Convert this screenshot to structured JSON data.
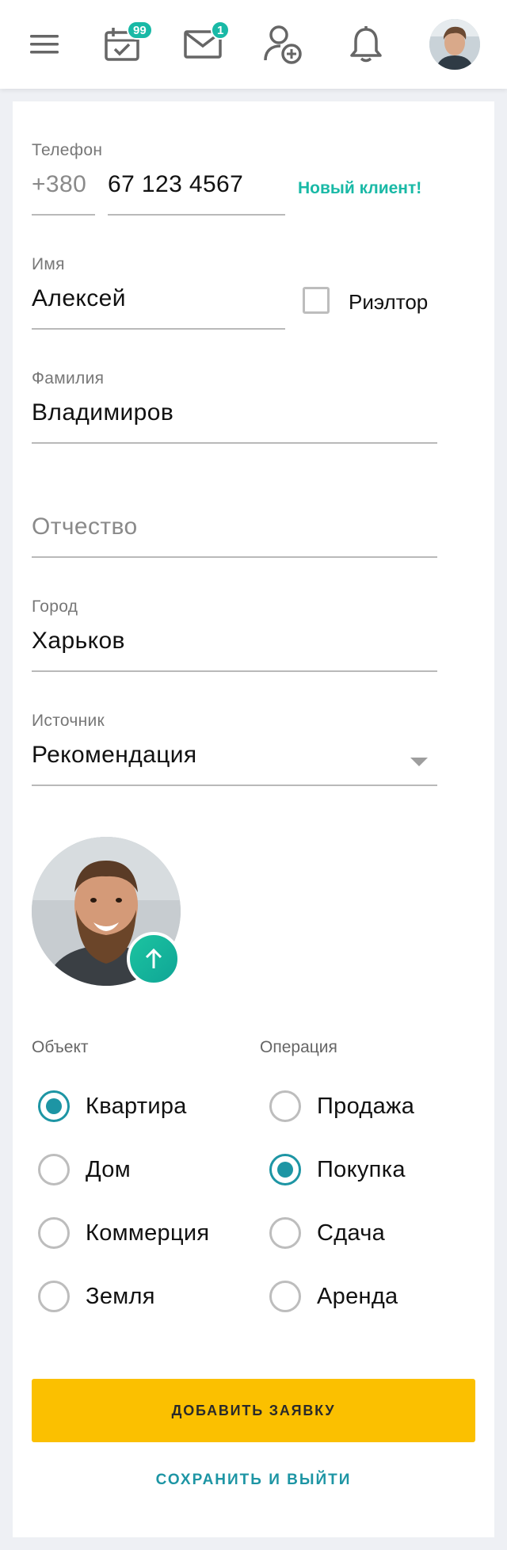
{
  "header": {
    "menu_icon": "hamburger-icon",
    "calendar_icon": "calendar-check-icon",
    "calendar_badge": "99",
    "mail_icon": "envelope-icon",
    "mail_badge": "1",
    "add_user_icon": "user-add-icon",
    "bell_icon": "bell-icon",
    "accent_color": "#19b9a6"
  },
  "form": {
    "phone": {
      "label": "Телефон",
      "prefix": "+380",
      "value": "67 123 4567",
      "status": "Новый клиент!"
    },
    "first_name": {
      "label": "Имя",
      "value": "Алексей"
    },
    "realtor": {
      "label": "Риэлтор",
      "checked": false
    },
    "last_name": {
      "label": "Фамилия",
      "value": "Владимиров"
    },
    "patronymic": {
      "placeholder": "Отчество",
      "value": ""
    },
    "city": {
      "label": "Город",
      "value": "Харьков"
    },
    "source": {
      "label": "Источник",
      "value": "Рекомендация"
    },
    "photo": {
      "upload_icon": "arrow-up-icon"
    }
  },
  "object": {
    "title": "Объект",
    "options": [
      {
        "label": "Квартира",
        "checked": true
      },
      {
        "label": "Дом",
        "checked": false
      },
      {
        "label": "Коммерция",
        "checked": false
      },
      {
        "label": "Земля",
        "checked": false
      }
    ]
  },
  "operation": {
    "title": "Операция",
    "options": [
      {
        "label": "Продажа",
        "checked": false
      },
      {
        "label": "Покупка",
        "checked": true
      },
      {
        "label": "Сдача",
        "checked": false
      },
      {
        "label": "Аренда",
        "checked": false
      }
    ]
  },
  "actions": {
    "primary": "ДОБАВИТЬ ЗАЯВКУ",
    "secondary": "СОХРАНИТЬ И ВЫЙТИ",
    "primary_color": "#fbc000",
    "link_color": "#1d95a4"
  }
}
